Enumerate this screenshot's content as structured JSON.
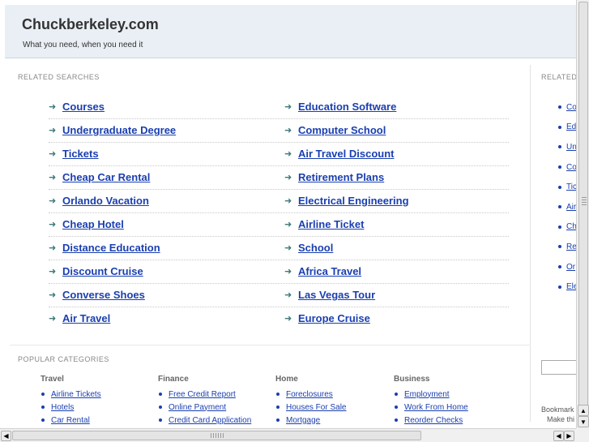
{
  "header": {
    "site_title": "Chuckberkeley.com",
    "tagline": "What you need, when you need it"
  },
  "related": {
    "heading": "RELATED SEARCHES",
    "rows": [
      {
        "left": "Courses",
        "right": "Education Software"
      },
      {
        "left": "Undergraduate Degree",
        "right": "Computer School"
      },
      {
        "left": "Tickets",
        "right": "Air Travel Discount"
      },
      {
        "left": "Cheap Car Rental",
        "right": "Retirement Plans"
      },
      {
        "left": "Orlando Vacation",
        "right": "Electrical Engineering"
      },
      {
        "left": "Cheap Hotel",
        "right": "Airline Ticket"
      },
      {
        "left": "Distance Education",
        "right": "School"
      },
      {
        "left": "Discount Cruise",
        "right": "Africa Travel"
      },
      {
        "left": "Converse Shoes",
        "right": "Las Vegas Tour"
      },
      {
        "left": "Air Travel",
        "right": "Europe Cruise"
      }
    ]
  },
  "popular": {
    "heading": "POPULAR CATEGORIES",
    "categories": [
      {
        "title": "Travel",
        "links": [
          "Airline Tickets",
          "Hotels",
          "Car Rental"
        ]
      },
      {
        "title": "Finance",
        "links": [
          "Free Credit Report",
          "Online Payment",
          "Credit Card Application"
        ]
      },
      {
        "title": "Home",
        "links": [
          "Foreclosures",
          "Houses For Sale",
          "Mortgage"
        ]
      },
      {
        "title": "Business",
        "links": [
          "Employment",
          "Work From Home",
          "Reorder Checks"
        ]
      }
    ]
  },
  "side": {
    "heading": "RELATED",
    "links": [
      "Co",
      "Ed",
      "Un",
      "Co",
      "Tic",
      "Air",
      "Ch",
      "Re",
      "Or",
      "Ele"
    ],
    "bookmark_line1": "Bookmark",
    "bookmark_line2": "Make thi"
  },
  "scrollbars": {
    "up_arrow": "▲",
    "down_arrow": "▼",
    "left_arrow": "◀",
    "right_arrow": "▶"
  },
  "icons": {
    "arrow": "➜"
  },
  "colors": {
    "link": "#1a3fb0",
    "header_bg": "#e9eff5",
    "arrow": "#3d7a7a"
  }
}
